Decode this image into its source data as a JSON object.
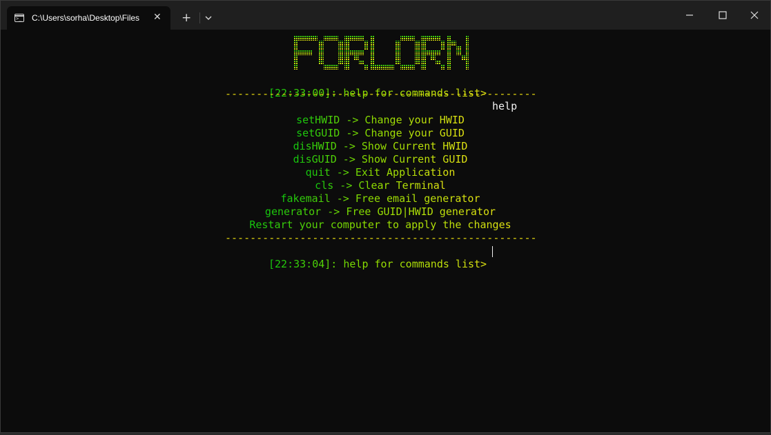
{
  "window": {
    "tab_title": "C:\\Users\\sorha\\Desktop\\Files",
    "tab_close_glyph": "✕",
    "new_tab_glyph": "+",
    "icons": {
      "tab_icon": "terminal-icon",
      "dropdown": "chevron-down-icon",
      "minimize": "minimize-icon",
      "maximize": "maximize-icon",
      "close": "close-icon"
    }
  },
  "logo": {
    "text": "FORLORN",
    "colors": [
      "#16c60c",
      "#e5e510"
    ]
  },
  "console": {
    "prompt1": {
      "prompt": "[22:33:00]: help for commands list> ",
      "input": "help"
    },
    "separator": "--------------------------------------------------",
    "help_lines": [
      "setHWID -> Change your HWID",
      "setGUID -> Change your GUID",
      "disHWID -> Show Current HWID",
      "disGUID -> Show Current GUID",
      "quit -> Exit Application",
      "cls -> Clear Terminal",
      "fakemail -> Free email generator",
      "generator -> Free GUID|HWID generator",
      "Restart your computer to apply the changes"
    ],
    "prompt2": {
      "prompt": "[22:33:04]: help for commands list> ",
      "input": ""
    }
  },
  "colors": {
    "background": "#0c0c0c",
    "green": "#16c60c",
    "yellow": "#e5e510",
    "white": "#f2f2f2"
  }
}
